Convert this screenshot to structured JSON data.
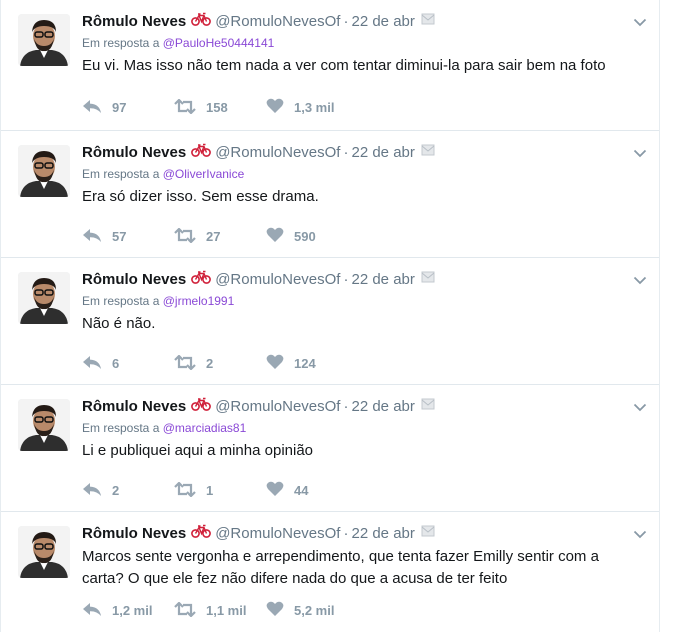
{
  "tweets": [
    {
      "name": "Rômulo Neves",
      "handle": "@RomuloNevesOf",
      "dot": "·",
      "time": "22 de abr",
      "reply_prefix": "Em resposta a",
      "reply_to": "@PauloHe50444141",
      "text": "Eu vi. Mas isso não tem nada a ver com tentar diminui-la para sair bem na foto",
      "replies": "97",
      "retweets": "158",
      "likes": "1,3 mil"
    },
    {
      "name": "Rômulo Neves",
      "handle": "@RomuloNevesOf",
      "dot": "·",
      "time": "22 de abr",
      "reply_prefix": "Em resposta a",
      "reply_to": "@OliverIvanice",
      "text": "Era só dizer isso. Sem esse drama.",
      "replies": "57",
      "retweets": "27",
      "likes": "590"
    },
    {
      "name": "Rômulo Neves",
      "handle": "@RomuloNevesOf",
      "dot": "·",
      "time": "22 de abr",
      "reply_prefix": "Em resposta a",
      "reply_to": "@jrmelo1991",
      "text": "Não é não.",
      "replies": "6",
      "retweets": "2",
      "likes": "124"
    },
    {
      "name": "Rômulo Neves",
      "handle": "@RomuloNevesOf",
      "dot": "·",
      "time": "22 de abr",
      "reply_prefix": "Em resposta a",
      "reply_to": "@marciadias81",
      "text": "Li e publiquei aqui a minha opinião",
      "replies": "2",
      "retweets": "1",
      "likes": "44"
    },
    {
      "name": "Rômulo Neves",
      "handle": "@RomuloNevesOf",
      "dot": "·",
      "time": "22 de abr",
      "reply_prefix": "",
      "reply_to": "",
      "text": "Marcos sente vergonha e arrependimento, que tenta fazer Emilly sentir com a carta? O que ele fez não difere nada do que a acusa de ter feito",
      "replies": "1,2 mil",
      "retweets": "1,1 mil",
      "likes": "5,2 mil"
    }
  ],
  "icons": {
    "reply": "reply-arrow-icon",
    "retweet": "retweet-icon",
    "like": "heart-icon",
    "menu": "chevron-down-icon",
    "emoji": "bicycle-icon",
    "dm": "message-icon"
  },
  "colors": {
    "text": "#14171a",
    "muted": "#657786",
    "link": "#8a49d6",
    "action": "#8899a6",
    "border": "#e1e8ed"
  }
}
